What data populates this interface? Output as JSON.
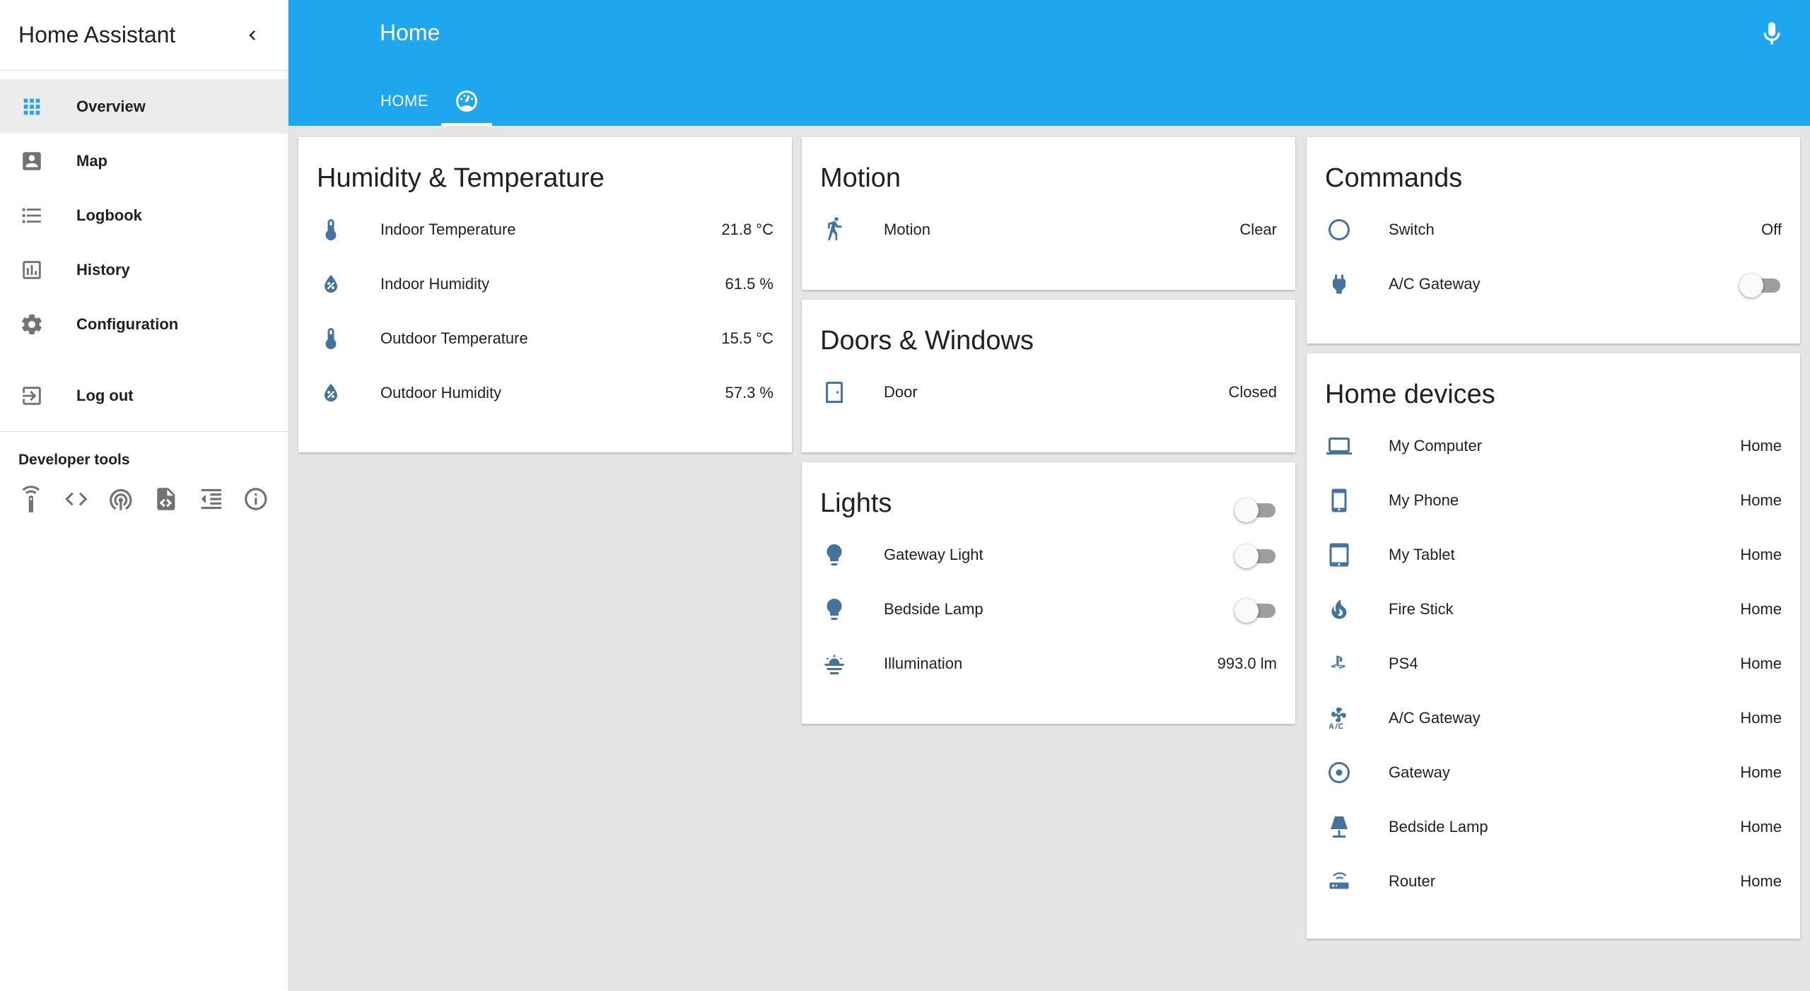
{
  "app": {
    "title": "Home Assistant"
  },
  "sidebar": {
    "items": [
      {
        "label": "Overview",
        "icon": "apps-icon",
        "active": true
      },
      {
        "label": "Map",
        "icon": "account-box-icon"
      },
      {
        "label": "Logbook",
        "icon": "format-list-bulleted-icon"
      },
      {
        "label": "History",
        "icon": "chart-box-icon"
      },
      {
        "label": "Configuration",
        "icon": "settings-icon"
      }
    ],
    "logout": "Log out",
    "developer_tools": {
      "title": "Developer tools",
      "icons": [
        "remote-icon",
        "code-tags-icon",
        "access-point-icon",
        "file-xml-icon",
        "format-indent-icon",
        "info-outline-icon"
      ]
    }
  },
  "header": {
    "title": "Home",
    "tabs": [
      {
        "label": "HOME"
      },
      {
        "icon": "gauge-icon",
        "active": true
      }
    ],
    "mic_icon": "microphone-icon"
  },
  "colors": {
    "accent": "#1ea7ee",
    "icon": "#44739e",
    "background": "#e5e5e5"
  },
  "cards": {
    "humidity": {
      "title": "Humidity & Temperature",
      "rows": [
        {
          "name": "Indoor Temperature",
          "value": "21.8 °C",
          "icon": "thermometer-icon"
        },
        {
          "name": "Indoor Humidity",
          "value": "61.5 %",
          "icon": "water-percent-icon"
        },
        {
          "name": "Outdoor Temperature",
          "value": "15.5 °C",
          "icon": "thermometer-icon"
        },
        {
          "name": "Outdoor Humidity",
          "value": "57.3 %",
          "icon": "water-percent-icon"
        }
      ]
    },
    "motion": {
      "title": "Motion",
      "rows": [
        {
          "name": "Motion",
          "value": "Clear",
          "icon": "walk-icon"
        }
      ]
    },
    "doors": {
      "title": "Doors & Windows",
      "rows": [
        {
          "name": "Door",
          "value": "Closed",
          "icon": "door-closed-icon"
        }
      ]
    },
    "lights": {
      "title": "Lights",
      "group_toggle": false,
      "rows": [
        {
          "name": "Gateway Light",
          "toggle": false,
          "icon": "lightbulb-icon"
        },
        {
          "name": "Bedside Lamp",
          "toggle": false,
          "icon": "lightbulb-icon"
        },
        {
          "name": "Illumination",
          "value": "993.0 lm",
          "icon": "weather-sunset-icon"
        }
      ]
    },
    "commands": {
      "title": "Commands",
      "rows": [
        {
          "name": "Switch",
          "value": "Off",
          "icon": "circle-outline-icon"
        },
        {
          "name": "A/C Gateway",
          "toggle": false,
          "icon": "power-plug-icon"
        }
      ]
    },
    "devices": {
      "title": "Home devices",
      "rows": [
        {
          "name": "My Computer",
          "value": "Home",
          "icon": "laptop-icon"
        },
        {
          "name": "My Phone",
          "value": "Home",
          "icon": "cellphone-icon"
        },
        {
          "name": "My Tablet",
          "value": "Home",
          "icon": "tablet-icon"
        },
        {
          "name": "Fire Stick",
          "value": "Home",
          "icon": "fire-icon"
        },
        {
          "name": "PS4",
          "value": "Home",
          "icon": "playstation-icon"
        },
        {
          "name": "A/C Gateway",
          "value": "Home",
          "icon": "air-conditioner-icon"
        },
        {
          "name": "Gateway",
          "value": "Home",
          "icon": "radiobox-marked-icon"
        },
        {
          "name": "Bedside Lamp",
          "value": "Home",
          "icon": "lamp-icon"
        },
        {
          "name": "Router",
          "value": "Home",
          "icon": "router-wireless-icon"
        }
      ]
    }
  }
}
